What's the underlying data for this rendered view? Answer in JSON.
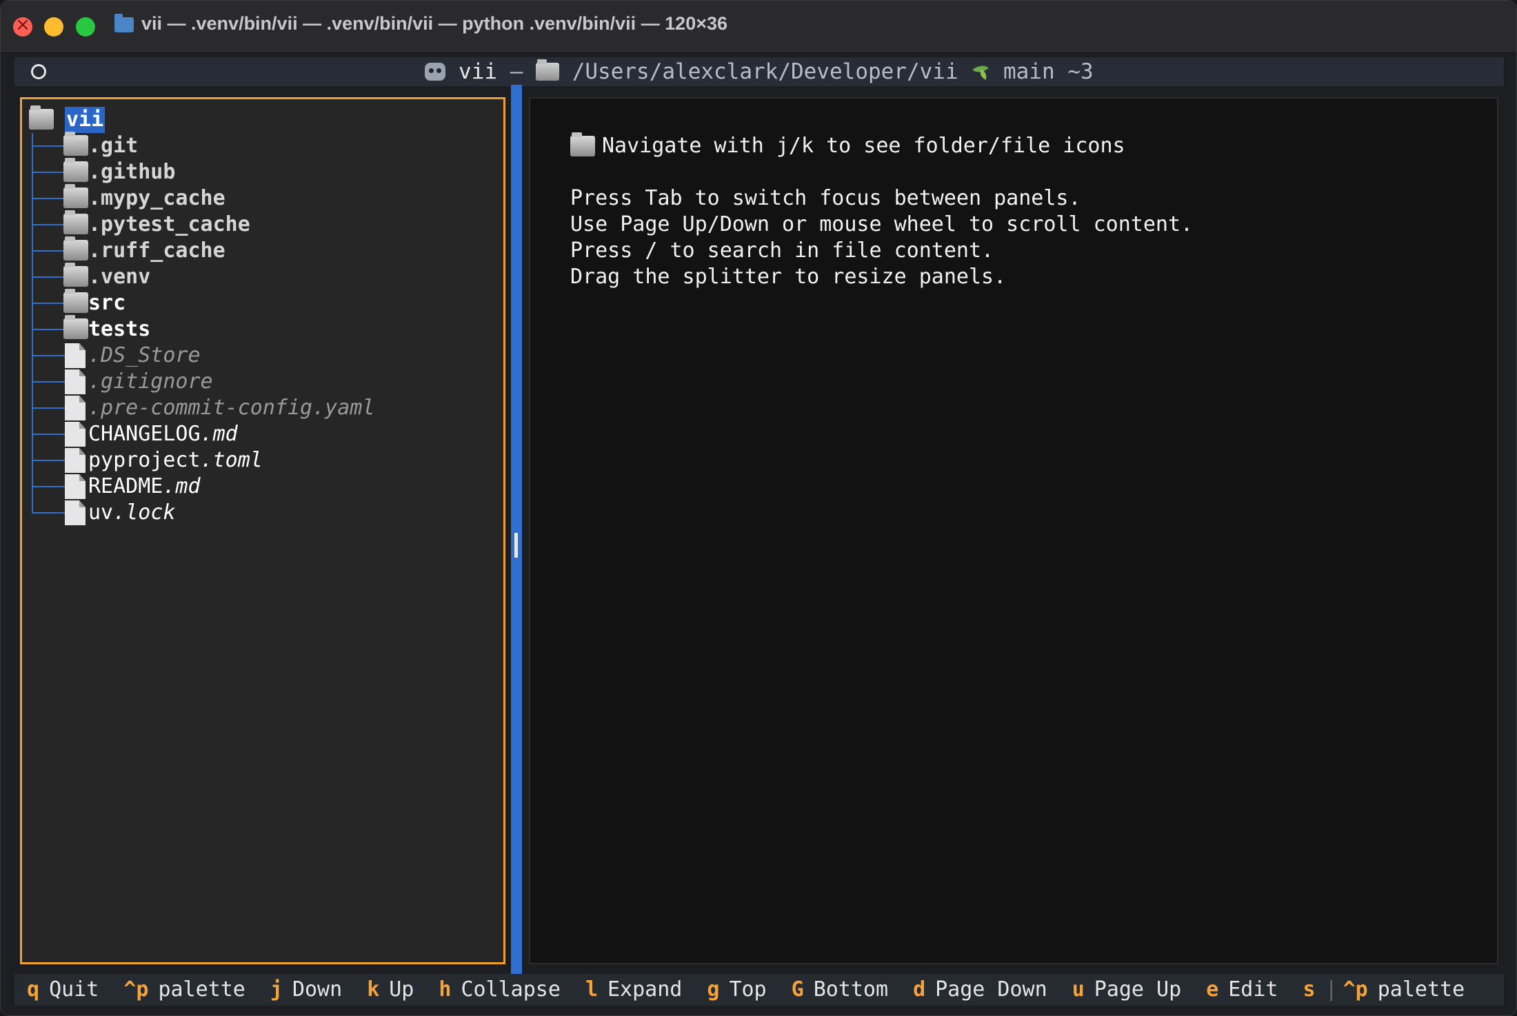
{
  "window": {
    "title": "vii — .venv/bin/vii — .venv/bin/vii — python .venv/bin/vii — 120×36"
  },
  "header": {
    "app": "vii",
    "separator": "—",
    "path": "/Users/alexclark/Developer/vii",
    "branch": "main ~3"
  },
  "tree": {
    "root": "vii",
    "items": [
      {
        "name": ".git",
        "kind": "folder"
      },
      {
        "name": ".github",
        "kind": "folder"
      },
      {
        "name": ".mypy_cache",
        "kind": "folder"
      },
      {
        "name": ".pytest_cache",
        "kind": "folder"
      },
      {
        "name": ".ruff_cache",
        "kind": "folder"
      },
      {
        "name": ".venv",
        "kind": "folder"
      },
      {
        "name": "src",
        "kind": "folder-bright"
      },
      {
        "name": "tests",
        "kind": "folder-bright"
      },
      {
        "name": ".DS_Store",
        "kind": "hidden"
      },
      {
        "name": ".gitignore",
        "kind": "hidden"
      },
      {
        "name": ".pre-commit-config.yaml",
        "kind": "hidden"
      },
      {
        "name": "CHANGELOG",
        "ext": ".md",
        "kind": "file"
      },
      {
        "name": "pyproject",
        "ext": ".toml",
        "kind": "file"
      },
      {
        "name": "README",
        "ext": ".md",
        "kind": "file"
      },
      {
        "name": "uv",
        "ext": ".lock",
        "kind": "file"
      }
    ]
  },
  "content": {
    "heading": "Navigate with j/k to see folder/file icons",
    "lines": [
      "Press Tab to switch focus between panels.",
      "Use Page Up/Down or mouse wheel to scroll content.",
      "Press / to search in file content.",
      "Drag the splitter to resize panels."
    ]
  },
  "footer": {
    "bindings": [
      {
        "key": "q",
        "label": "Quit"
      },
      {
        "key": "^p",
        "label": "palette"
      },
      {
        "key": "j",
        "label": "Down"
      },
      {
        "key": "k",
        "label": "Up"
      },
      {
        "key": "h",
        "label": "Collapse"
      },
      {
        "key": "l",
        "label": "Expand"
      },
      {
        "key": "g",
        "label": "Top"
      },
      {
        "key": "G",
        "label": "Bottom"
      },
      {
        "key": "d",
        "label": "Page Down"
      },
      {
        "key": "u",
        "label": "Page Up"
      },
      {
        "key": "e",
        "label": "Edit"
      },
      {
        "key": "s",
        "label": ""
      }
    ],
    "separator": "|",
    "palette": {
      "key": "^p",
      "label": "palette"
    }
  },
  "colors": {
    "accent": "#f0a030",
    "selection": "#2a66c8",
    "splitter": "#2f6fd0"
  }
}
